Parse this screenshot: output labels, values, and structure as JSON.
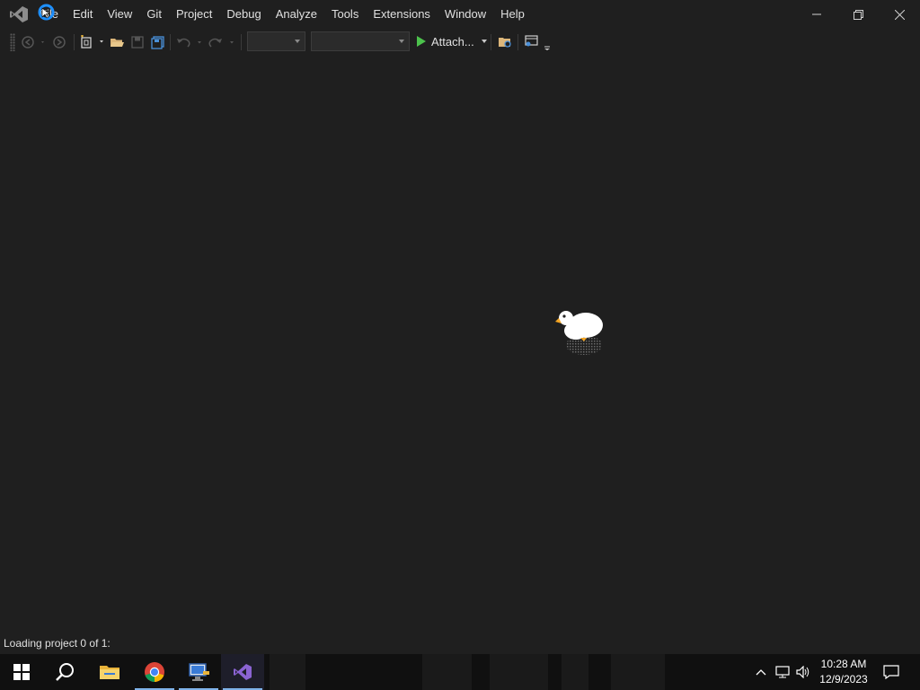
{
  "menu": {
    "items": [
      {
        "label": "File",
        "name": "menu-file"
      },
      {
        "label": "Edit",
        "name": "menu-edit"
      },
      {
        "label": "View",
        "name": "menu-view"
      },
      {
        "label": "Git",
        "name": "menu-git"
      },
      {
        "label": "Project",
        "name": "menu-project"
      },
      {
        "label": "Debug",
        "name": "menu-debug"
      },
      {
        "label": "Analyze",
        "name": "menu-analyze"
      },
      {
        "label": "Tools",
        "name": "menu-tools"
      },
      {
        "label": "Extensions",
        "name": "menu-extensions"
      },
      {
        "label": "Window",
        "name": "menu-window"
      },
      {
        "label": "Help",
        "name": "menu-help"
      }
    ]
  },
  "toolbar": {
    "attach_label": "Attach...",
    "icons": [
      "navigate-back-icon",
      "navigate-forward-icon",
      "new-project-icon",
      "open-file-icon",
      "save-icon",
      "save-all-icon",
      "undo-icon",
      "redo-icon",
      "solution-explorer-icon",
      "layout-icon"
    ]
  },
  "status": {
    "text": "Loading project 0 of 1:"
  },
  "taskbar": {
    "apps": [
      "windows-start-icon",
      "search-icon",
      "file-explorer-icon",
      "chrome-icon",
      "remote-desktop-icon",
      "visual-studio-icon"
    ],
    "time": "10:28 AM",
    "date": "12/9/2023"
  },
  "colors": {
    "background": "#1f1f1f",
    "taskbar": "#101010",
    "accent_blue": "#1e90ff",
    "vs_purple": "#8a63d2",
    "run_green": "#4cc24c"
  }
}
